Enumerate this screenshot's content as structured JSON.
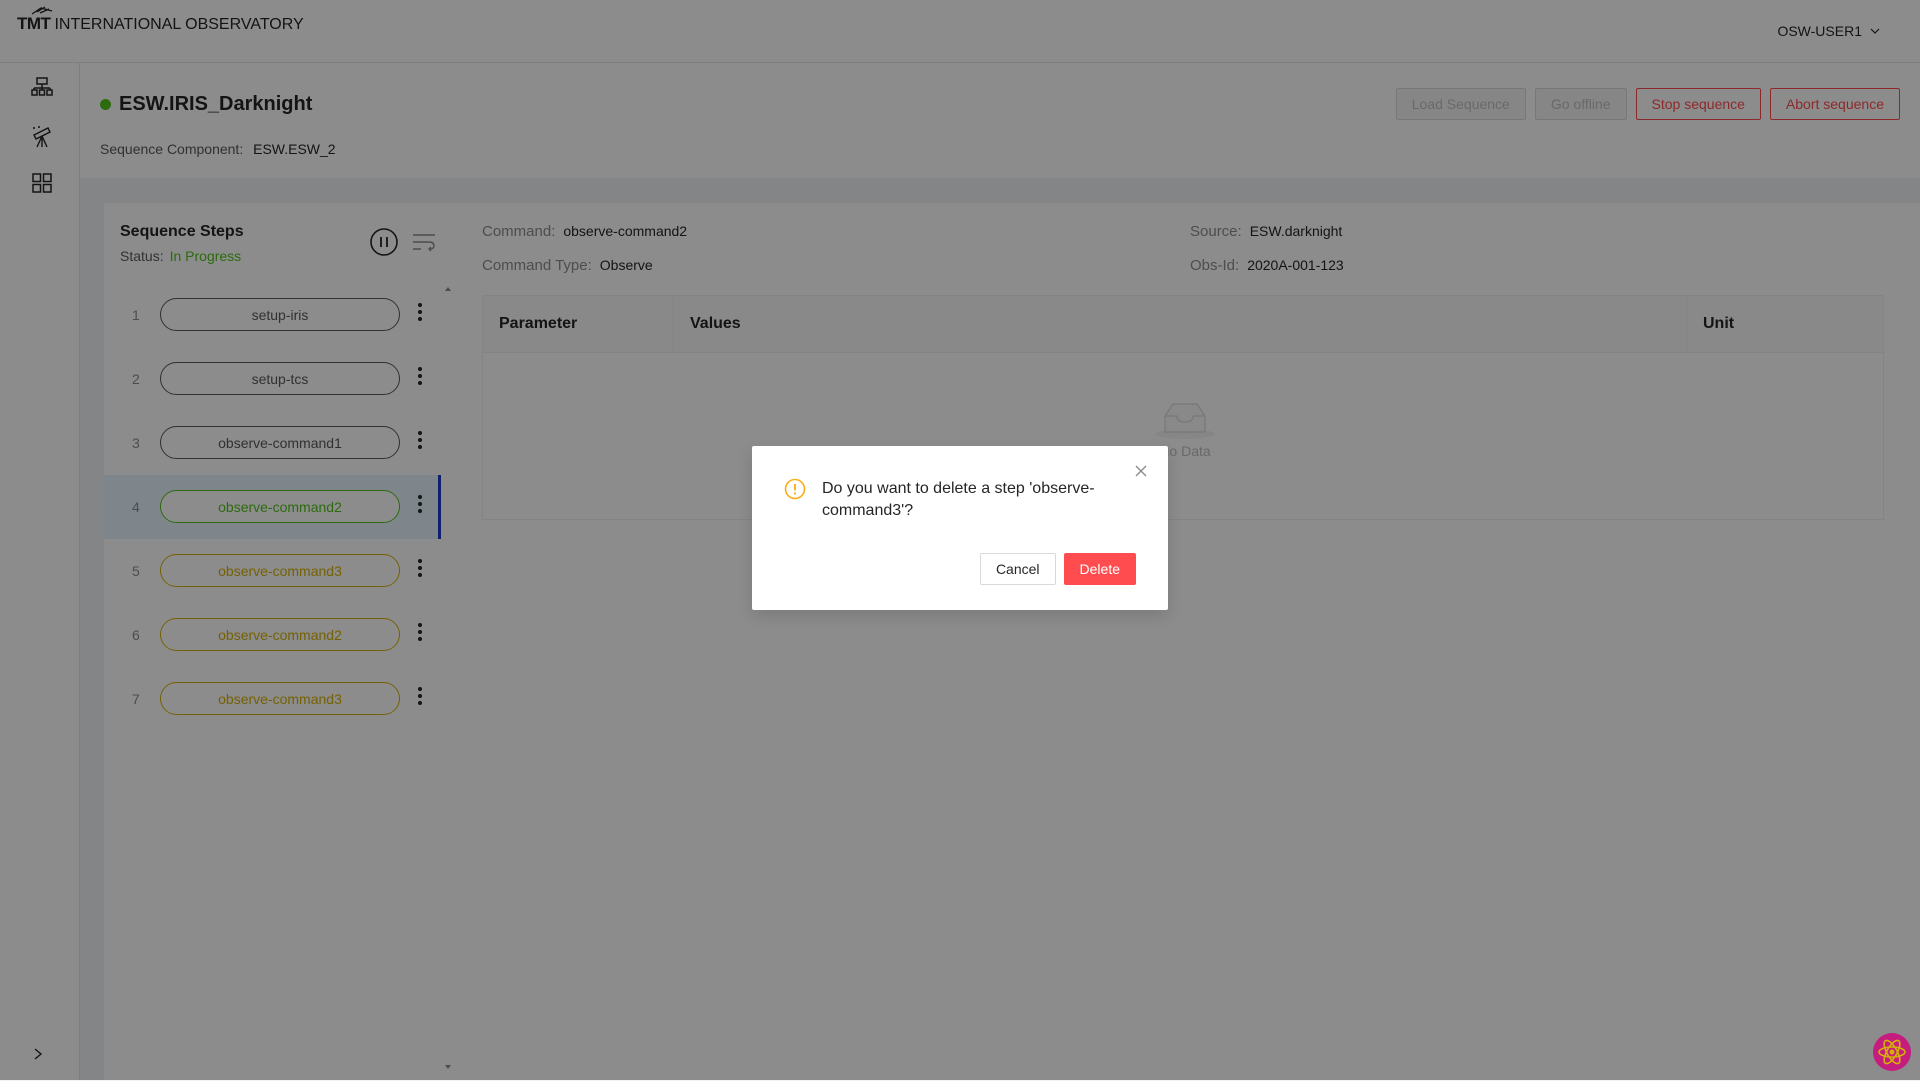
{
  "header": {
    "logo_text": "TMT",
    "org_name": "INTERNATIONAL OBSERVATORY",
    "user": "OSW-USER1"
  },
  "sidenav": {
    "items": [
      {
        "icon": "hierarchy-icon"
      },
      {
        "icon": "telescope-icon"
      },
      {
        "icon": "grid-icon"
      }
    ],
    "collapse_icon": "chevron-right-icon"
  },
  "sequencer": {
    "name": "ESW.IRIS_Darknight",
    "status_color": "#52c41a",
    "component_label": "Sequence Component:",
    "component_value": "ESW.ESW_2",
    "actions": {
      "load": "Load Sequence",
      "offline": "Go offline",
      "stop": "Stop sequence",
      "abort": "Abort sequence"
    }
  },
  "steps": {
    "title": "Sequence Steps",
    "status_label": "Status:",
    "status_value": "In Progress",
    "items": [
      {
        "num": "1",
        "label": "setup-iris",
        "state": "done"
      },
      {
        "num": "2",
        "label": "setup-tcs",
        "state": "done"
      },
      {
        "num": "3",
        "label": "observe-command1",
        "state": "done"
      },
      {
        "num": "4",
        "label": "observe-command2",
        "state": "progress"
      },
      {
        "num": "5",
        "label": "observe-command3",
        "state": "pending"
      },
      {
        "num": "6",
        "label": "observe-command2",
        "state": "pending"
      },
      {
        "num": "7",
        "label": "observe-command3",
        "state": "pending"
      }
    ]
  },
  "details": {
    "command_label": "Command:",
    "command_value": "observe-command2",
    "type_label": "Command Type:",
    "type_value": "Observe",
    "source_label": "Source:",
    "source_value": "ESW.darknight",
    "obsid_label": "Obs-Id:",
    "obsid_value": "2020A-001-123",
    "table": {
      "headers": [
        "Parameter",
        "Values",
        "Unit"
      ],
      "empty_text": "No Data"
    }
  },
  "modal": {
    "message": "Do you want to delete a step 'observe-command3'?",
    "cancel": "Cancel",
    "delete": "Delete"
  }
}
